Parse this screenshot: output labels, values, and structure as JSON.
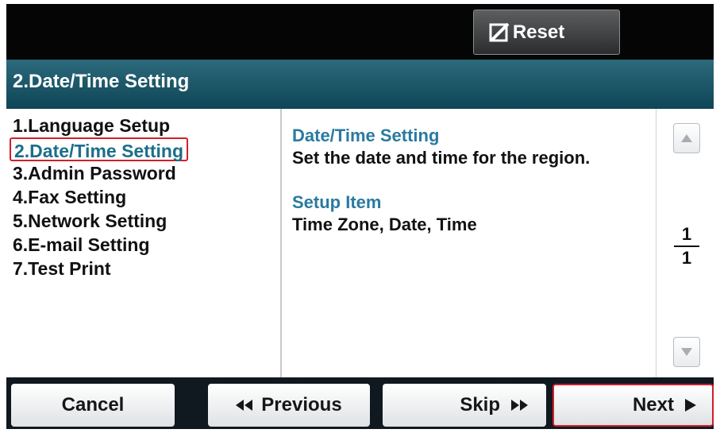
{
  "header": {
    "reset_label": "Reset"
  },
  "title_bar": {
    "title": "2.Date/Time Setting"
  },
  "menu": {
    "items": [
      {
        "label": "1.Language Setup",
        "selected": false
      },
      {
        "label": "2.Date/Time Setting",
        "selected": true
      },
      {
        "label": "3.Admin Password",
        "selected": false
      },
      {
        "label": "4.Fax Setting",
        "selected": false
      },
      {
        "label": "5.Network Setting",
        "selected": false
      },
      {
        "label": "6.E-mail Setting",
        "selected": false
      },
      {
        "label": "7.Test Print",
        "selected": false
      }
    ]
  },
  "detail": {
    "heading": "Date/Time Setting",
    "description": "Set the date and time for the region.",
    "setup_heading": "Setup Item",
    "setup_items": "Time Zone, Date, Time"
  },
  "pager": {
    "current": "1",
    "total": "1"
  },
  "footer": {
    "cancel_label": "Cancel",
    "previous_label": "Previous",
    "skip_label": "Skip",
    "next_label": "Next"
  },
  "icons": {
    "reset": "reset-icon",
    "scroll_up": "up-arrow-icon",
    "scroll_down": "down-arrow-icon",
    "previous": "double-left-arrow-icon",
    "skip": "double-right-arrow-icon",
    "next": "right-triangle-icon"
  },
  "colors": {
    "title_bar": "#1a5a6c",
    "selection_highlight": "#d21f2b",
    "heading_text": "#2a7aa0",
    "selected_item_text": "#1b6f8a"
  }
}
